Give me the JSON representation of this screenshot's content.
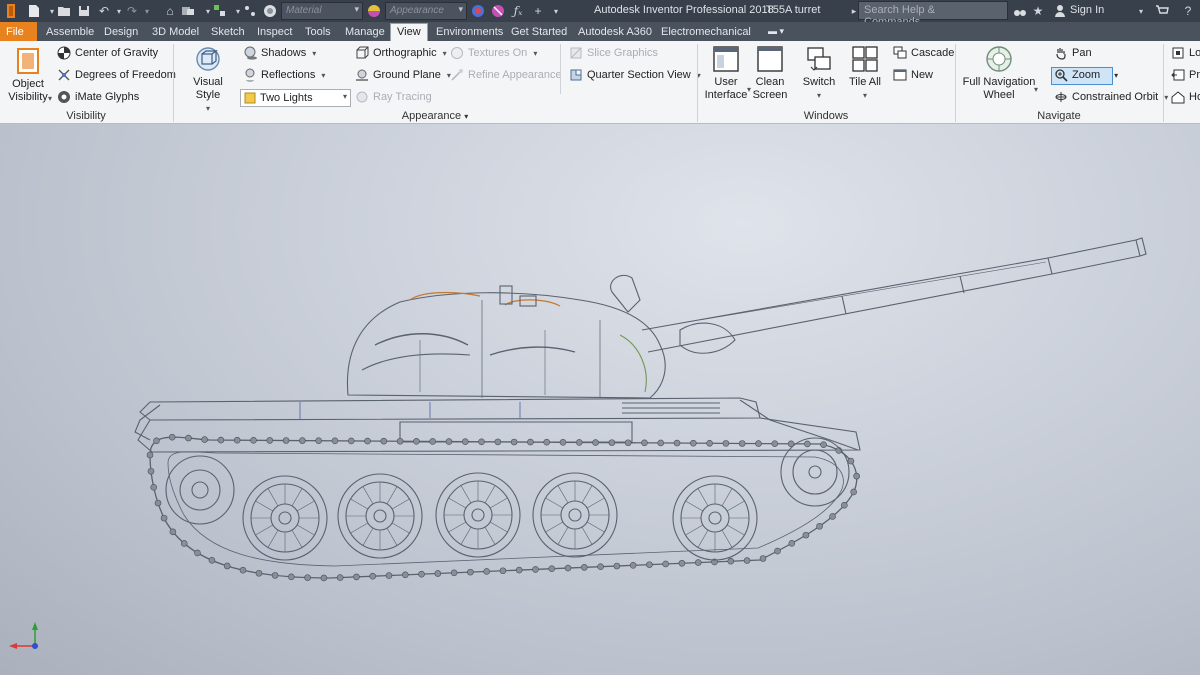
{
  "app": {
    "title": "Autodesk Inventor Professional 2018",
    "document": "T55A turret",
    "search_placeholder": "Search Help & Commands...",
    "sign_in": "Sign In",
    "material_combo": "Material",
    "appearance_combo": "Appearance"
  },
  "tabs": [
    "File",
    "Assemble",
    "Design",
    "3D Model",
    "Sketch",
    "Inspect",
    "Tools",
    "Manage",
    "View",
    "Environments",
    "Get Started",
    "Autodesk A360",
    "Electromechanical"
  ],
  "active_tab": "View",
  "ribbon": {
    "visibility": {
      "label": "Visibility",
      "object_visibility": "Object Visibility",
      "object_visibility_l1": "Object",
      "object_visibility_l2": "Visibility",
      "center_of_gravity": "Center of Gravity",
      "degrees_of_freedom": "Degrees of Freedom",
      "imate_glyphs": "iMate Glyphs"
    },
    "appearance": {
      "label": "Appearance",
      "visual_style": "Visual Style",
      "shadows": "Shadows",
      "reflections": "Reflections",
      "lights": "Two Lights",
      "orthographic": "Orthographic",
      "ground_plane": "Ground Plane",
      "ray_tracing": "Ray Tracing",
      "textures_on": "Textures On",
      "refine_appearance": "Refine Appearance",
      "slice_graphics": "Slice Graphics",
      "quarter_section_view": "Quarter Section View"
    },
    "windows": {
      "label": "Windows",
      "user_interface_l1": "User",
      "user_interface_l2": "Interface",
      "clean_screen_l1": "Clean",
      "clean_screen_l2": "Screen",
      "switch": "Switch",
      "tile_all": "Tile All",
      "cascade": "Cascade",
      "new": "New"
    },
    "navigate": {
      "label": "Navigate",
      "full_nav_wheel_l1": "Full Navigation",
      "full_nav_wheel_l2": "Wheel",
      "pan": "Pan",
      "zoom": "Zoom",
      "constrained_orbit": "Constrained Orbit",
      "look": "Lo",
      "previous": "Pre",
      "home": "Ho"
    }
  },
  "colors": {
    "titlebar": "#38404b",
    "tabbar": "#4a525d",
    "file_tab": "#e8821e",
    "ribbon": "#f4f5f6",
    "zoom_highlight": "#cfe4f7",
    "model_line": "#5a6270"
  }
}
